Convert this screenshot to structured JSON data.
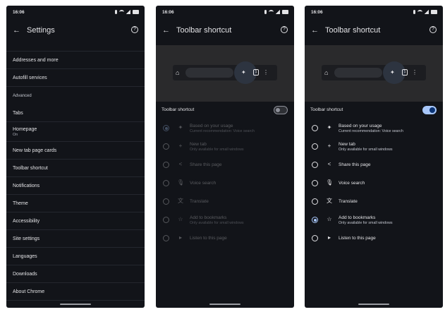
{
  "status": {
    "time": "16:06"
  },
  "settings_screen": {
    "title": "Settings",
    "items": [
      {
        "label": "Addresses and more"
      },
      {
        "label": "Autofill services"
      },
      {
        "label": "Advanced",
        "section": true
      },
      {
        "label": "Tabs"
      },
      {
        "label": "Homepage",
        "sub": "On"
      },
      {
        "label": "New tab page cards"
      },
      {
        "label": "Toolbar shortcut"
      },
      {
        "label": "Notifications"
      },
      {
        "label": "Theme"
      },
      {
        "label": "Accessibility"
      },
      {
        "label": "Site settings"
      },
      {
        "label": "Languages"
      },
      {
        "label": "Downloads"
      },
      {
        "label": "About Chrome"
      }
    ]
  },
  "toolbar_screen": {
    "title": "Toolbar shortcut",
    "toggle_label": "Toolbar shortcut",
    "options": [
      {
        "title": "Based on your usage",
        "sub": "Current recommendation: Voice search",
        "icon": "sparkle-icon",
        "glyph": "✦"
      },
      {
        "title": "New tab",
        "sub": "Only available for small windows",
        "icon": "plus-icon",
        "glyph": "+"
      },
      {
        "title": "Share this page",
        "sub": "",
        "icon": "share-icon",
        "glyph": "<"
      },
      {
        "title": "Voice search",
        "sub": "",
        "icon": "mic-icon",
        "glyph": "🎙"
      },
      {
        "title": "Translate",
        "sub": "",
        "icon": "translate-icon",
        "glyph": "文"
      },
      {
        "title": "Add to bookmarks",
        "sub": "Only available for small windows",
        "icon": "star-icon",
        "glyph": "☆"
      },
      {
        "title": "Listen to this page",
        "sub": "",
        "icon": "play-circle-icon",
        "glyph": "▸"
      }
    ]
  },
  "screens": [
    {
      "toggle_on": false,
      "selected_option": 0
    },
    {
      "toggle_on": true,
      "selected_option": 5
    }
  ],
  "colors": {
    "background": "#121419",
    "accent": "#a8c7fa",
    "divider": "#24272e"
  }
}
